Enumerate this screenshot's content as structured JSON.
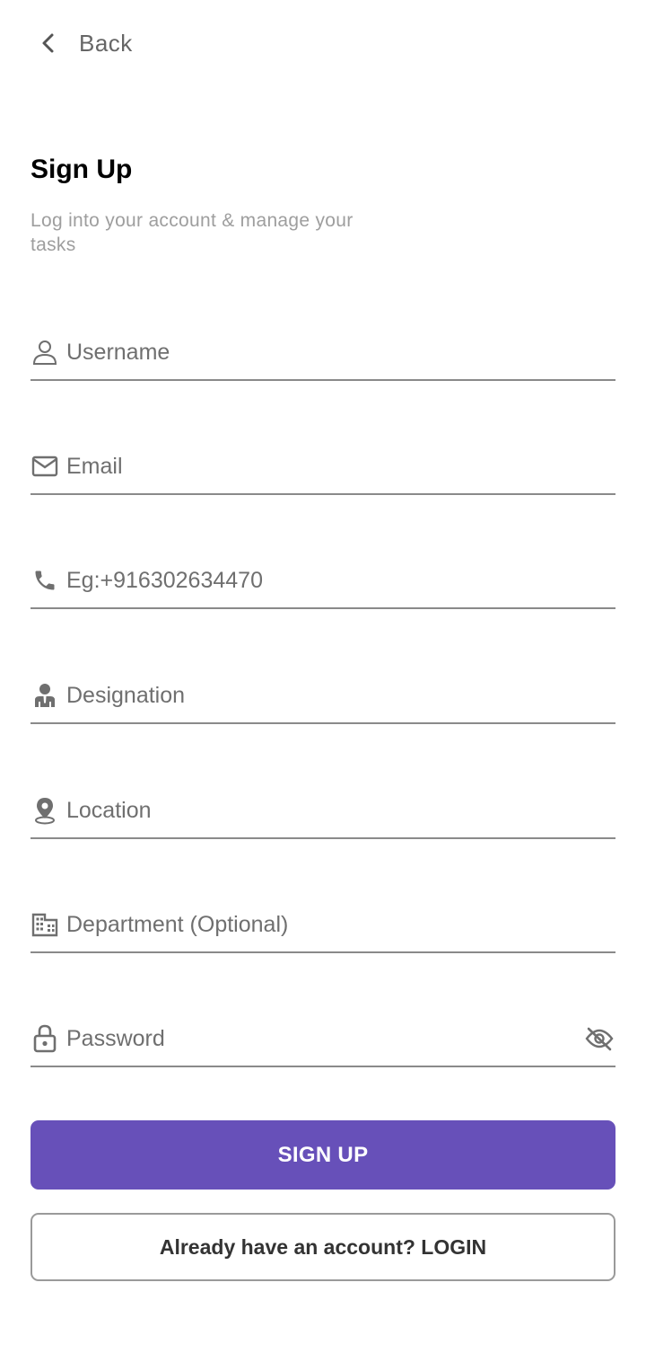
{
  "header": {
    "back_label": "Back",
    "back_icon": "chevron-left-icon"
  },
  "title": "Sign Up",
  "subtitle": "Log into your account & manage your tasks",
  "form": {
    "fields": [
      {
        "name": "username",
        "icon": "user-icon",
        "placeholder": "Username",
        "value": ""
      },
      {
        "name": "email",
        "icon": "mail-icon",
        "placeholder": "Email",
        "value": ""
      },
      {
        "name": "phone",
        "icon": "phone-icon",
        "placeholder": "Eg:+916302634470",
        "value": ""
      },
      {
        "name": "designation",
        "icon": "person-suit-icon",
        "placeholder": "Designation",
        "value": ""
      },
      {
        "name": "location",
        "icon": "location-pin-icon",
        "placeholder": "Location",
        "value": ""
      },
      {
        "name": "department",
        "icon": "building-icon",
        "placeholder": "Department (Optional)",
        "value": ""
      },
      {
        "name": "password",
        "icon": "lock-icon",
        "placeholder": "Password",
        "value": "",
        "toggle_icon": "eye-off-icon"
      }
    ]
  },
  "buttons": {
    "signup_label": "SIGN UP",
    "login_label": "Already have an account? LOGIN"
  },
  "colors": {
    "accent": "#6750b9",
    "divider": "#8a8a8a",
    "icon": "#6f6f6f",
    "subtitle": "#9e9e9e"
  }
}
